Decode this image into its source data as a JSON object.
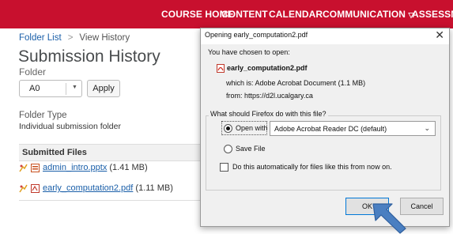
{
  "nav": {
    "items": [
      "COURSE HOME",
      "CONTENT",
      "CALENDAR",
      "COMMUNICATION",
      "ASSESSMI"
    ],
    "chevron": "▽"
  },
  "breadcrumb": {
    "parent": "Folder List",
    "separator": ">",
    "current": "View History"
  },
  "page": {
    "title": "Submission History",
    "folder_label": "Folder",
    "folder_value": "A0",
    "apply_label": "Apply",
    "folder_type_label": "Folder Type",
    "folder_type_value": "Individual submission folder",
    "submitted_files_header": "Submitted Files",
    "files": [
      {
        "name": "admin_intro.pptx",
        "size": "(1.41 MB)"
      },
      {
        "name": "early_computation2.pdf",
        "size": "(1.11 MB)"
      }
    ]
  },
  "dialog": {
    "title": "Opening early_computation2.pdf",
    "close_glyph": "✕",
    "chosen_text": "You have chosen to open:",
    "filename": "early_computation2.pdf",
    "which_is": "which is: Adobe Acrobat Document (1.1 MB)",
    "from": "from: https://d2l.ucalgary.ca",
    "question": "What should Firefox do with this file?",
    "open_with_label": "Open with",
    "open_with_app": "Adobe Acrobat Reader DC  (default)",
    "save_file_label": "Save File",
    "auto_label": "Do this automatically for files like this from now on.",
    "ok_label": "OK",
    "cancel_label": "Cancel"
  },
  "colors": {
    "nav_bg": "#c8102e",
    "link": "#1a5fa9",
    "cursor_fill": "#4a7fc1"
  }
}
